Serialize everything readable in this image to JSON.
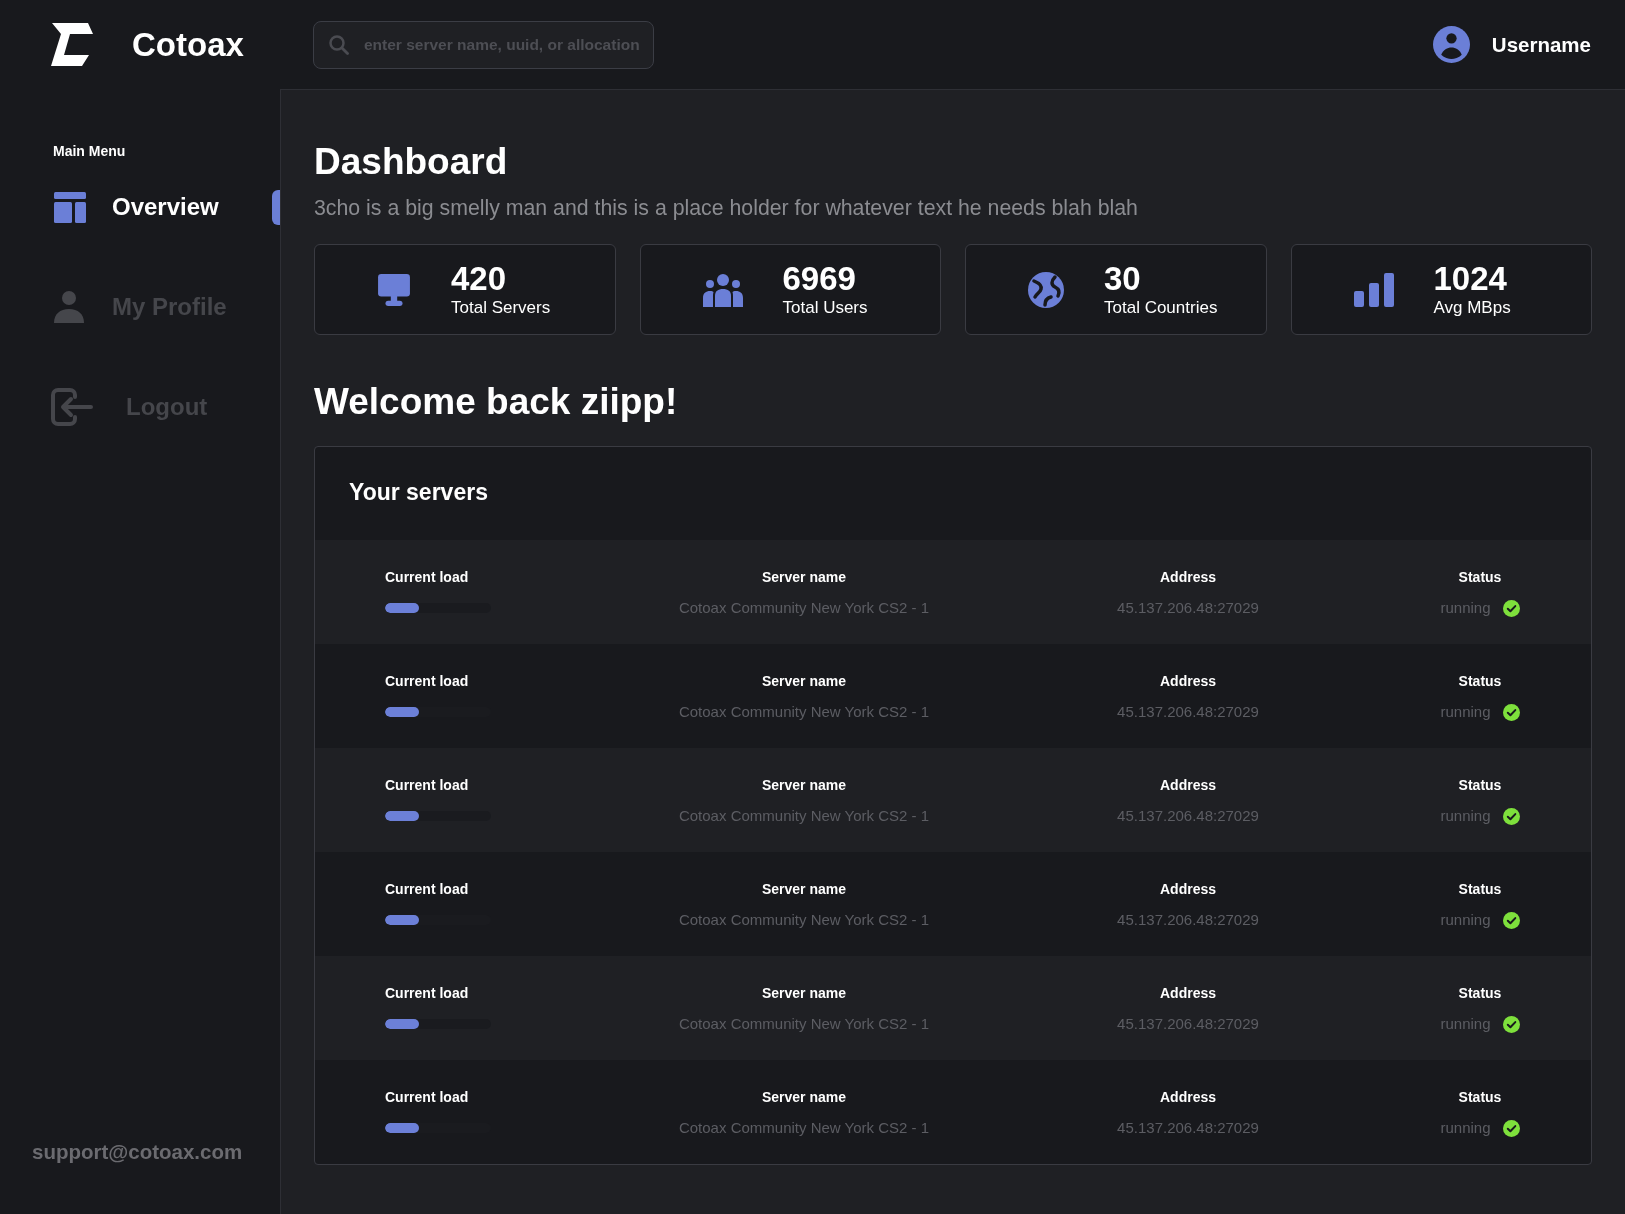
{
  "header": {
    "brand": "Cotoax",
    "search": {
      "placeholder": "enter server name, uuid, or allocation"
    },
    "user": "Username"
  },
  "sidebar": {
    "heading": "Main Menu",
    "items": [
      {
        "label": "Overview",
        "selected": true
      },
      {
        "label": "My Profile",
        "selected": false
      },
      {
        "label": "Logout",
        "selected": false
      }
    ],
    "footer": "support@cotoax.com"
  },
  "main": {
    "title": "Dashboard",
    "subtitle": "3cho is a big smelly man and this is a place holder for whatever text he needs blah blah",
    "stats": [
      {
        "value": "420",
        "label": "Total Servers"
      },
      {
        "value": "6969",
        "label": "Total Users"
      },
      {
        "value": "30",
        "label": "Total Countries"
      },
      {
        "value": "1024",
        "label": "Avg MBps"
      }
    ],
    "welcome": "Welcome back ziipp!",
    "servers": {
      "title": "Your servers",
      "rows": [
        {
          "load_label": "Current load",
          "level": 0.32,
          "name_label": "Server name",
          "name": "Cotoax Community New York CS2 - 1",
          "address_label": "Address",
          "address": "45.137.206.48:27029",
          "status_label": "Status",
          "status": "running"
        },
        {
          "load_label": "Current load",
          "level": 0.32,
          "name_label": "Server name",
          "name": "Cotoax Community New York CS2 - 1",
          "address_label": "Address",
          "address": "45.137.206.48:27029",
          "status_label": "Status",
          "status": "running"
        },
        {
          "load_label": "Current load",
          "level": 0.32,
          "name_label": "Server name",
          "name": "Cotoax Community New York CS2 - 1",
          "address_label": "Address",
          "address": "45.137.206.48:27029",
          "status_label": "Status",
          "status": "running"
        },
        {
          "load_label": "Current load",
          "level": 0.32,
          "name_label": "Server name",
          "name": "Cotoax Community New York CS2 - 1",
          "address_label": "Address",
          "address": "45.137.206.48:27029",
          "status_label": "Status",
          "status": "running"
        },
        {
          "load_label": "Current load",
          "level": 0.32,
          "name_label": "Server name",
          "name": "Cotoax Community New York CS2 - 1",
          "address_label": "Address",
          "address": "45.137.206.48:27029",
          "status_label": "Status",
          "status": "running"
        },
        {
          "load_label": "Current load",
          "level": 0.32,
          "name_label": "Server name",
          "name": "Cotoax Community New York CS2 - 1",
          "address_label": "Address",
          "address": "45.137.206.48:27029",
          "status_label": "Status",
          "status": "running"
        }
      ]
    }
  }
}
